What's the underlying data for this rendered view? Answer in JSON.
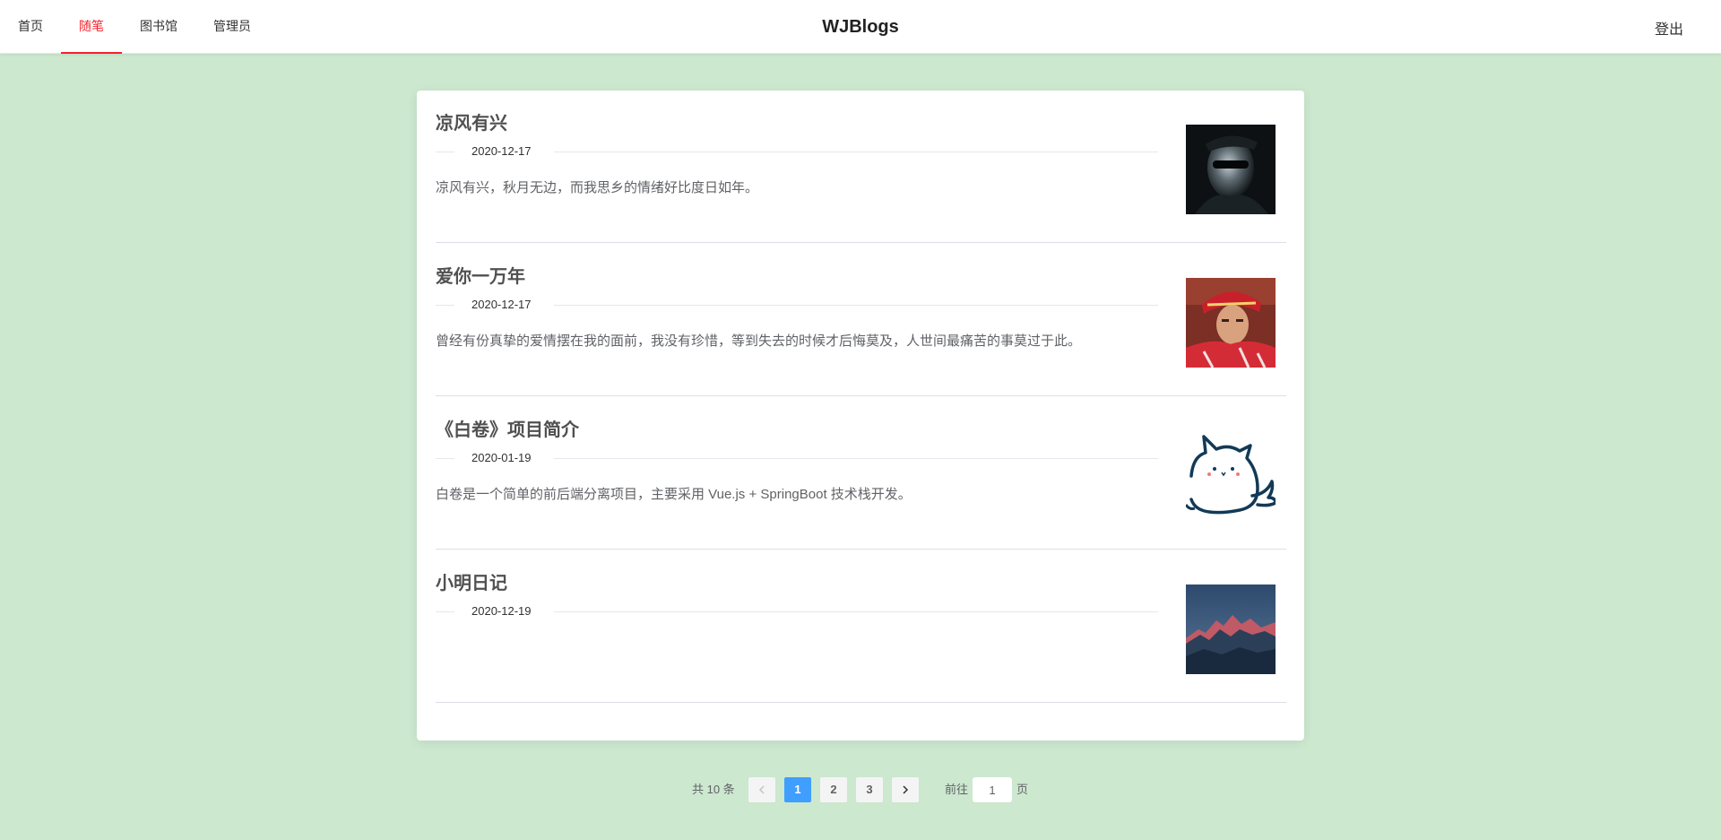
{
  "nav": {
    "items": [
      {
        "label": "首页"
      },
      {
        "label": "随笔"
      },
      {
        "label": "图书馆"
      },
      {
        "label": "管理员"
      }
    ],
    "active_index": 1,
    "brand": "WJBlogs",
    "logout": "登出"
  },
  "articles": [
    {
      "title": "凉风有兴",
      "date": "2020-12-17",
      "abstract": "凉风有兴，秋月无边，而我思乡的情绪好比度日如年。",
      "thumb_icon": "portrait-sunglasses-photo"
    },
    {
      "title": "爱你一万年",
      "date": "2020-12-17",
      "abstract": "曾经有份真挚的爱情摆在我的面前，我没有珍惜，等到失去的时候才后悔莫及，人世间最痛苦的事莫过于此。",
      "thumb_icon": "portrait-red-headdress-photo"
    },
    {
      "title": "《白卷》项目简介",
      "date": "2020-01-19",
      "abstract": "白卷是一个简单的前后端分离项目，主要采用 Vue.js + SpringBoot 技术栈开发。",
      "thumb_icon": "cat-doodle-illustration"
    },
    {
      "title": "小明日记",
      "date": "2020-12-19",
      "abstract": "",
      "thumb_icon": "mountain-sunset-photo"
    }
  ],
  "pagination": {
    "total_text": "共 10 条",
    "pages": [
      "1",
      "2",
      "3"
    ],
    "current": "1",
    "prev_icon": "chevron-left-icon",
    "next_icon": "chevron-right-icon",
    "goto_label": "前往",
    "goto_value": "1",
    "page_suffix": "页"
  },
  "colors": {
    "background": "#cce8cf",
    "nav_active": "#f5222d",
    "pager_active": "#409eff"
  }
}
